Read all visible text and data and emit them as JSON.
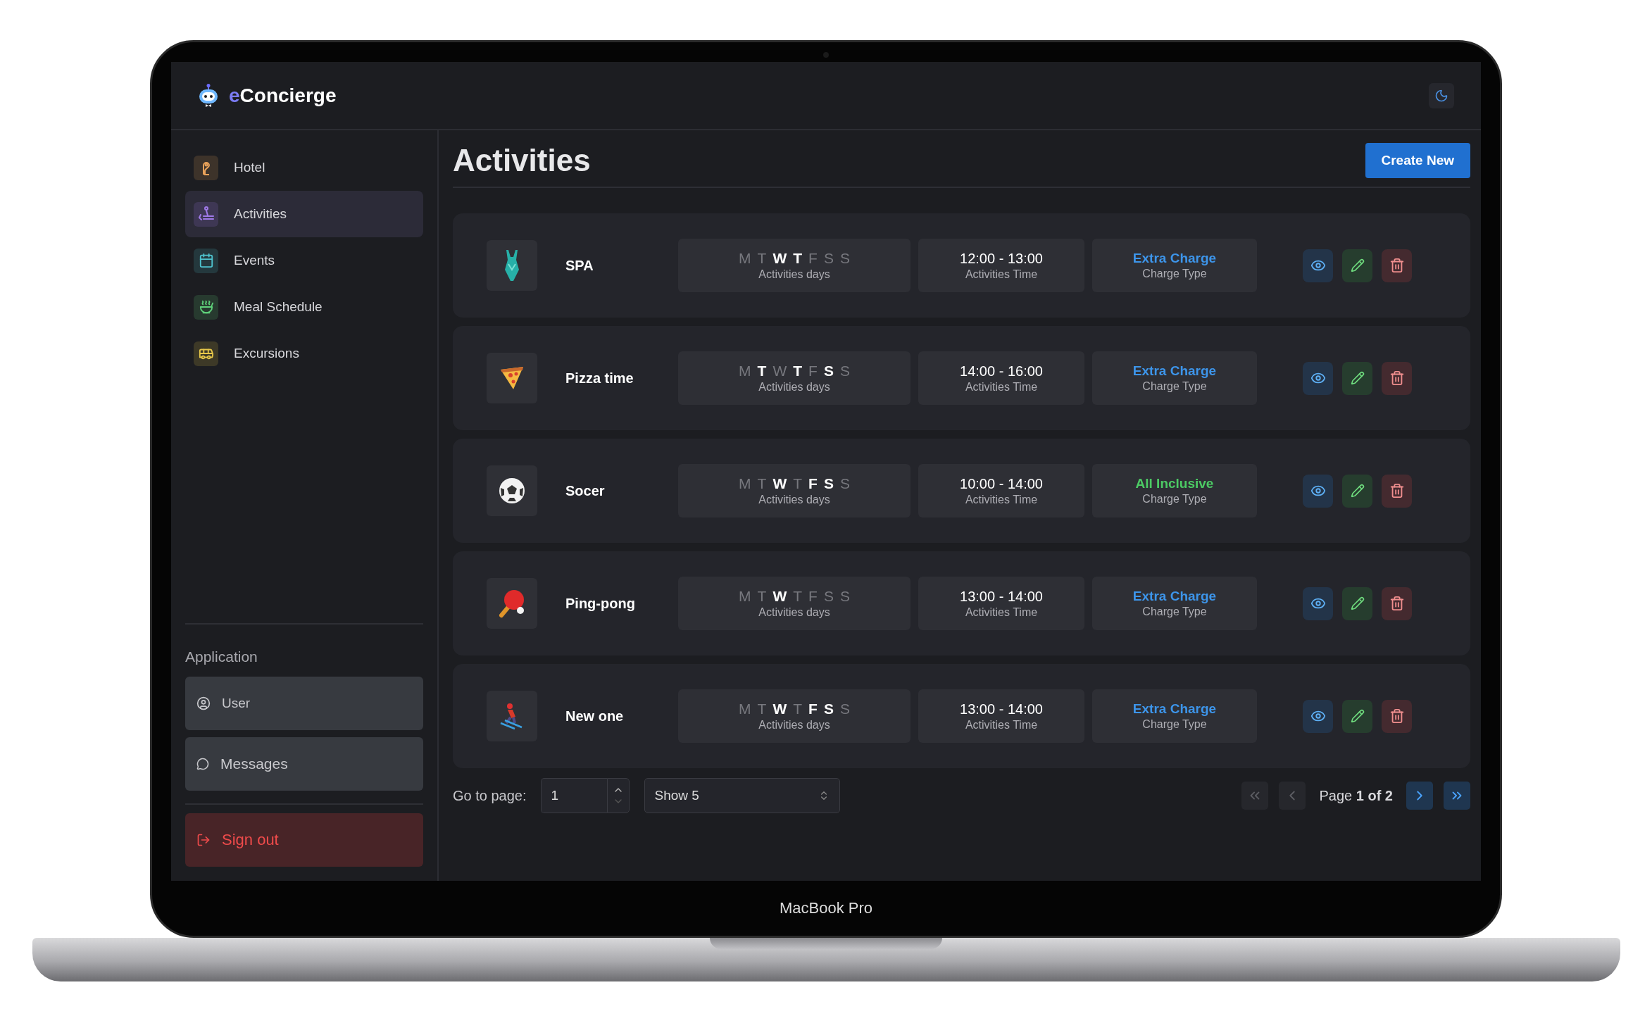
{
  "header": {
    "logo": {
      "accent": "e",
      "text": "Concierge"
    }
  },
  "sidebar": {
    "items": [
      {
        "label": "Hotel",
        "selected": false,
        "color": "#e8a25a"
      },
      {
        "label": "Activities",
        "selected": true,
        "color": "#a07ae8"
      },
      {
        "label": "Events",
        "selected": false,
        "color": "#4fc4cf"
      },
      {
        "label": "Meal Schedule",
        "selected": false,
        "color": "#5fd07a"
      },
      {
        "label": "Excursions",
        "selected": false,
        "color": "#e8c84a"
      }
    ],
    "section_title": "Application",
    "app_items": [
      {
        "label": "User"
      },
      {
        "label": "Messages"
      }
    ],
    "sign_out": "Sign out"
  },
  "main": {
    "title": "Activities",
    "create_button": "Create New",
    "rows": [
      {
        "name": "SPA",
        "days": [
          {
            "letter": "M",
            "on": false
          },
          {
            "letter": "T",
            "on": false
          },
          {
            "letter": "W",
            "on": true
          },
          {
            "letter": "T",
            "on": true
          },
          {
            "letter": "F",
            "on": false
          },
          {
            "letter": "S",
            "on": false
          },
          {
            "letter": "S",
            "on": false
          }
        ],
        "days_label": "Activities days",
        "time": "12:00 - 13:00",
        "time_label": "Activities Time",
        "charge": {
          "text": "Extra Charge",
          "kind": "extra"
        },
        "charge_label": "Charge Type"
      },
      {
        "name": "Pizza time",
        "days": [
          {
            "letter": "M",
            "on": false
          },
          {
            "letter": "T",
            "on": true
          },
          {
            "letter": "W",
            "on": false
          },
          {
            "letter": "T",
            "on": true
          },
          {
            "letter": "F",
            "on": false
          },
          {
            "letter": "S",
            "on": true
          },
          {
            "letter": "S",
            "on": false
          }
        ],
        "days_label": "Activities days",
        "time": "14:00 - 16:00",
        "time_label": "Activities Time",
        "charge": {
          "text": "Extra Charge",
          "kind": "extra"
        },
        "charge_label": "Charge Type"
      },
      {
        "name": "Socer",
        "days": [
          {
            "letter": "M",
            "on": false
          },
          {
            "letter": "T",
            "on": false
          },
          {
            "letter": "W",
            "on": true
          },
          {
            "letter": "T",
            "on": false
          },
          {
            "letter": "F",
            "on": true
          },
          {
            "letter": "S",
            "on": true
          },
          {
            "letter": "S",
            "on": false
          }
        ],
        "days_label": "Activities days",
        "time": "10:00 - 14:00",
        "time_label": "Activities Time",
        "charge": {
          "text": "All Inclusive",
          "kind": "inclusive"
        },
        "charge_label": "Charge Type"
      },
      {
        "name": "Ping-pong",
        "days": [
          {
            "letter": "M",
            "on": false
          },
          {
            "letter": "T",
            "on": false
          },
          {
            "letter": "W",
            "on": true
          },
          {
            "letter": "T",
            "on": false
          },
          {
            "letter": "F",
            "on": false
          },
          {
            "letter": "S",
            "on": false
          },
          {
            "letter": "S",
            "on": false
          }
        ],
        "days_label": "Activities days",
        "time": "13:00 - 14:00",
        "time_label": "Activities Time",
        "charge": {
          "text": "Extra Charge",
          "kind": "extra"
        },
        "charge_label": "Charge Type"
      },
      {
        "name": "New one",
        "days": [
          {
            "letter": "M",
            "on": false
          },
          {
            "letter": "T",
            "on": false
          },
          {
            "letter": "W",
            "on": true
          },
          {
            "letter": "T",
            "on": false
          },
          {
            "letter": "F",
            "on": true
          },
          {
            "letter": "S",
            "on": true
          },
          {
            "letter": "S",
            "on": false
          }
        ],
        "days_label": "Activities days",
        "time": "13:00 - 14:00",
        "time_label": "Activities Time",
        "charge": {
          "text": "Extra Charge",
          "kind": "extra"
        },
        "charge_label": "Charge Type"
      }
    ],
    "pagination": {
      "goto_label": "Go to page:",
      "page_value": "1",
      "page_size": "Show 5",
      "page_text": "Page **1 of 2**",
      "buttons": [
        {
          "kind": "first",
          "disabled": true
        },
        {
          "kind": "prev",
          "disabled": true
        },
        {
          "kind": "next",
          "disabled": false
        },
        {
          "kind": "last",
          "disabled": false
        }
      ]
    }
  },
  "device": {
    "label": "MacBook Pro"
  }
}
